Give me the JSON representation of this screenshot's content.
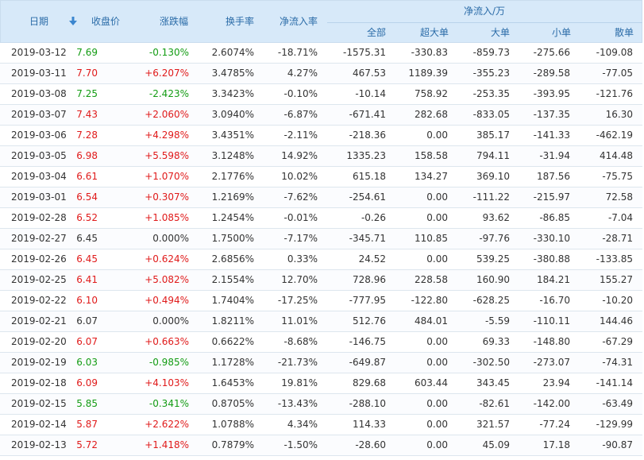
{
  "colors": {
    "header_bg": "#d7e9f9",
    "header_text": "#2b6ca8",
    "up": "#e01a1a",
    "down": "#139c13",
    "flat": "#333333"
  },
  "header": {
    "date": "日期",
    "sort_icon": "arrow-down-icon",
    "close": "收盘价",
    "change": "涨跌幅",
    "turnover": "换手率",
    "net_rate": "净流入率",
    "net_group": "净流入/万",
    "all": "全部",
    "xl": "超大单",
    "l": "大单",
    "s": "小单",
    "r": "散单"
  },
  "rows": [
    {
      "date": "2019-03-12",
      "close": "7.69",
      "change": "-0.130%",
      "turnover": "2.6074%",
      "rate": "-18.71%",
      "all": "-1575.31",
      "xl": "-330.83",
      "l": "-859.73",
      "s": "-275.66",
      "r": "-109.08",
      "dir": "down"
    },
    {
      "date": "2019-03-11",
      "close": "7.70",
      "change": "+6.207%",
      "turnover": "3.4785%",
      "rate": "4.27%",
      "all": "467.53",
      "xl": "1189.39",
      "l": "-355.23",
      "s": "-289.58",
      "r": "-77.05",
      "dir": "up"
    },
    {
      "date": "2019-03-08",
      "close": "7.25",
      "change": "-2.423%",
      "turnover": "3.3423%",
      "rate": "-0.10%",
      "all": "-10.14",
      "xl": "758.92",
      "l": "-253.35",
      "s": "-393.95",
      "r": "-121.76",
      "dir": "down"
    },
    {
      "date": "2019-03-07",
      "close": "7.43",
      "change": "+2.060%",
      "turnover": "3.0940%",
      "rate": "-6.87%",
      "all": "-671.41",
      "xl": "282.68",
      "l": "-833.05",
      "s": "-137.35",
      "r": "16.30",
      "dir": "up"
    },
    {
      "date": "2019-03-06",
      "close": "7.28",
      "change": "+4.298%",
      "turnover": "3.4351%",
      "rate": "-2.11%",
      "all": "-218.36",
      "xl": "0.00",
      "l": "385.17",
      "s": "-141.33",
      "r": "-462.19",
      "dir": "up"
    },
    {
      "date": "2019-03-05",
      "close": "6.98",
      "change": "+5.598%",
      "turnover": "3.1248%",
      "rate": "14.92%",
      "all": "1335.23",
      "xl": "158.58",
      "l": "794.11",
      "s": "-31.94",
      "r": "414.48",
      "dir": "up"
    },
    {
      "date": "2019-03-04",
      "close": "6.61",
      "change": "+1.070%",
      "turnover": "2.1776%",
      "rate": "10.02%",
      "all": "615.18",
      "xl": "134.27",
      "l": "369.10",
      "s": "187.56",
      "r": "-75.75",
      "dir": "up"
    },
    {
      "date": "2019-03-01",
      "close": "6.54",
      "change": "+0.307%",
      "turnover": "1.2169%",
      "rate": "-7.62%",
      "all": "-254.61",
      "xl": "0.00",
      "l": "-111.22",
      "s": "-215.97",
      "r": "72.58",
      "dir": "up"
    },
    {
      "date": "2019-02-28",
      "close": "6.52",
      "change": "+1.085%",
      "turnover": "1.2454%",
      "rate": "-0.01%",
      "all": "-0.26",
      "xl": "0.00",
      "l": "93.62",
      "s": "-86.85",
      "r": "-7.04",
      "dir": "up"
    },
    {
      "date": "2019-02-27",
      "close": "6.45",
      "change": "0.000%",
      "turnover": "1.7500%",
      "rate": "-7.17%",
      "all": "-345.71",
      "xl": "110.85",
      "l": "-97.76",
      "s": "-330.10",
      "r": "-28.71",
      "dir": "flat"
    },
    {
      "date": "2019-02-26",
      "close": "6.45",
      "change": "+0.624%",
      "turnover": "2.6856%",
      "rate": "0.33%",
      "all": "24.52",
      "xl": "0.00",
      "l": "539.25",
      "s": "-380.88",
      "r": "-133.85",
      "dir": "up"
    },
    {
      "date": "2019-02-25",
      "close": "6.41",
      "change": "+5.082%",
      "turnover": "2.1554%",
      "rate": "12.70%",
      "all": "728.96",
      "xl": "228.58",
      "l": "160.90",
      "s": "184.21",
      "r": "155.27",
      "dir": "up"
    },
    {
      "date": "2019-02-22",
      "close": "6.10",
      "change": "+0.494%",
      "turnover": "1.7404%",
      "rate": "-17.25%",
      "all": "-777.95",
      "xl": "-122.80",
      "l": "-628.25",
      "s": "-16.70",
      "r": "-10.20",
      "dir": "up"
    },
    {
      "date": "2019-02-21",
      "close": "6.07",
      "change": "0.000%",
      "turnover": "1.8211%",
      "rate": "11.01%",
      "all": "512.76",
      "xl": "484.01",
      "l": "-5.59",
      "s": "-110.11",
      "r": "144.46",
      "dir": "flat"
    },
    {
      "date": "2019-02-20",
      "close": "6.07",
      "change": "+0.663%",
      "turnover": "0.6622%",
      "rate": "-8.68%",
      "all": "-146.75",
      "xl": "0.00",
      "l": "69.33",
      "s": "-148.80",
      "r": "-67.29",
      "dir": "up"
    },
    {
      "date": "2019-02-19",
      "close": "6.03",
      "change": "-0.985%",
      "turnover": "1.1728%",
      "rate": "-21.73%",
      "all": "-649.87",
      "xl": "0.00",
      "l": "-302.50",
      "s": "-273.07",
      "r": "-74.31",
      "dir": "down"
    },
    {
      "date": "2019-02-18",
      "close": "6.09",
      "change": "+4.103%",
      "turnover": "1.6453%",
      "rate": "19.81%",
      "all": "829.68",
      "xl": "603.44",
      "l": "343.45",
      "s": "23.94",
      "r": "-141.14",
      "dir": "up"
    },
    {
      "date": "2019-02-15",
      "close": "5.85",
      "change": "-0.341%",
      "turnover": "0.8705%",
      "rate": "-13.43%",
      "all": "-288.10",
      "xl": "0.00",
      "l": "-82.61",
      "s": "-142.00",
      "r": "-63.49",
      "dir": "down"
    },
    {
      "date": "2019-02-14",
      "close": "5.87",
      "change": "+2.622%",
      "turnover": "1.0788%",
      "rate": "4.34%",
      "all": "114.33",
      "xl": "0.00",
      "l": "321.57",
      "s": "-77.24",
      "r": "-129.99",
      "dir": "up"
    },
    {
      "date": "2019-02-13",
      "close": "5.72",
      "change": "+1.418%",
      "turnover": "0.7879%",
      "rate": "-1.50%",
      "all": "-28.60",
      "xl": "0.00",
      "l": "45.09",
      "s": "17.18",
      "r": "-90.87",
      "dir": "up"
    }
  ]
}
